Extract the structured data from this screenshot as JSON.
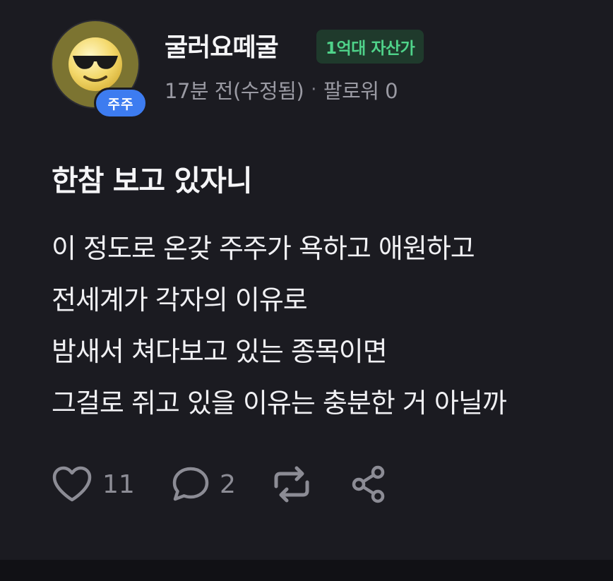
{
  "post": {
    "author": {
      "username": "굴러요떼굴",
      "rank_badge": "1억대 자산가",
      "holder_badge": "주주",
      "avatar_icon": "sunglasses-emoji-icon"
    },
    "meta": {
      "time": "17분 전(수정됨)",
      "separator": "·",
      "followers": "팔로워 0"
    },
    "title": "한참 보고 있자니",
    "body_lines": [
      "이 정도로 온갖 주주가 욕하고 애원하고",
      "전세계가 각자의 이유로",
      "밤새서 쳐다보고 있는 종목이면",
      "그걸로 쥐고 있을 이유는 충분한 거 아닐까"
    ],
    "actions": {
      "likes": "11",
      "comments": "2",
      "like_icon": "heart-icon",
      "comment_icon": "speech-bubble-icon",
      "repost_icon": "repost-icon",
      "share_icon": "share-icon"
    }
  },
  "colors": {
    "background": "#1b1b21",
    "holder_badge": "#3d7cf0",
    "rank_badge_bg": "#1f3a2c",
    "rank_badge_text": "#4fd38a",
    "muted_text": "#9a9aa3"
  }
}
